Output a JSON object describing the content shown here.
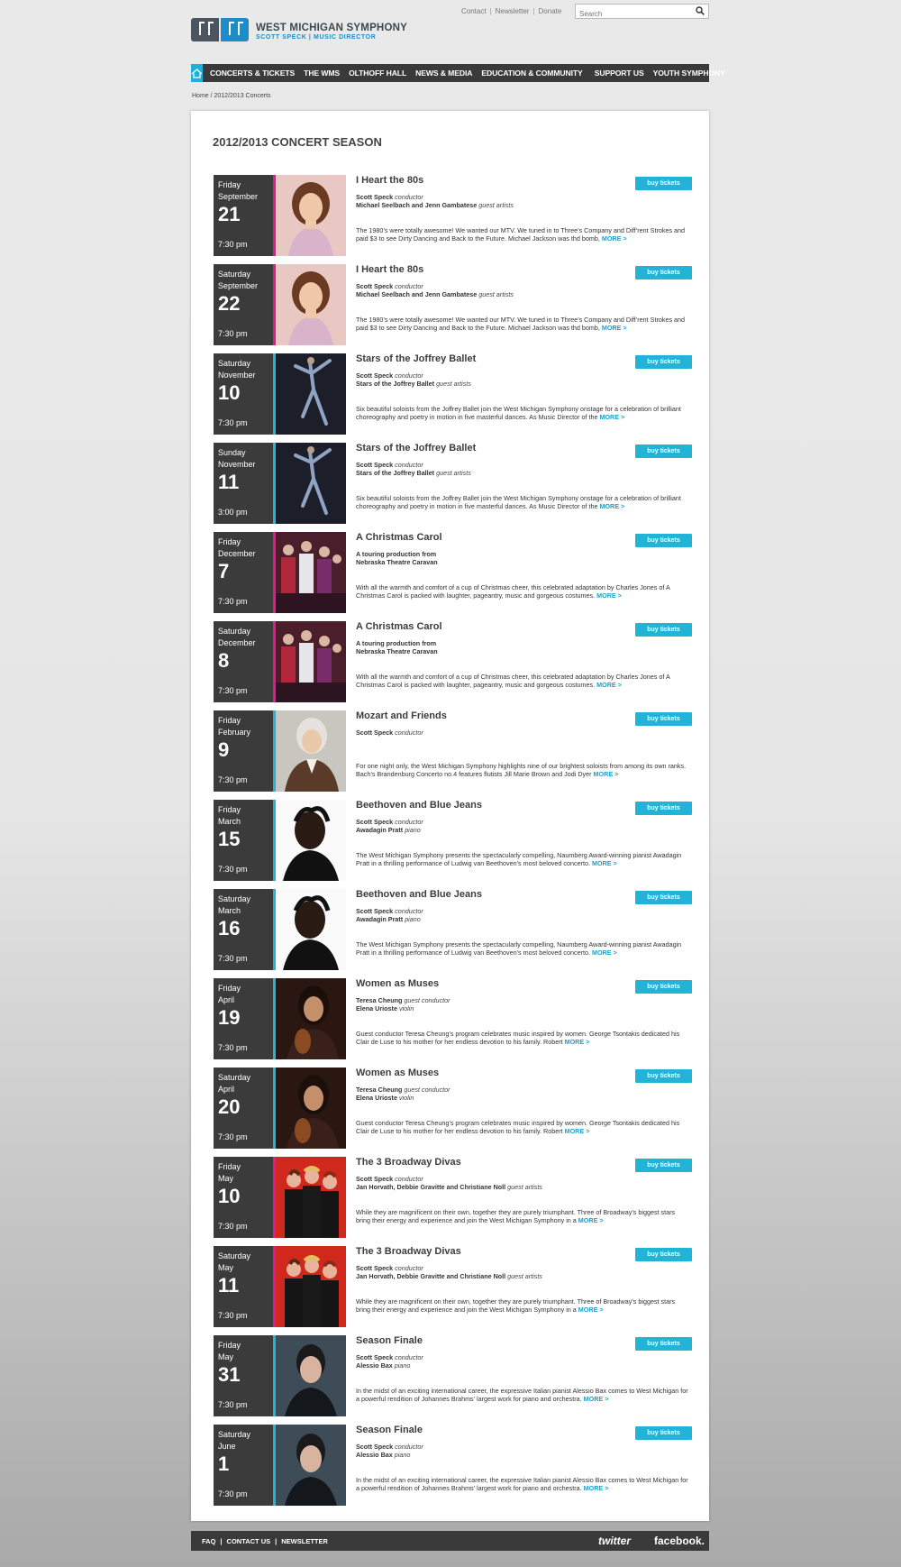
{
  "header": {
    "logo_title": "WEST MICHIGAN SYMPHONY",
    "logo_subtitle": "SCOTT SPECK | MUSIC DIRECTOR",
    "util_links": [
      "Contact",
      "Newsletter",
      "Donate"
    ],
    "search_placeholder": "Search"
  },
  "nav": {
    "items": [
      "CONCERTS & TICKETS",
      "THE WMS",
      "OLTHOFF HALL",
      "NEWS & MEDIA",
      "EDUCATION & COMMUNITY",
      "SUPPORT US",
      "YOUTH SYMPHONY"
    ]
  },
  "breadcrumb": "Home / 2012/2013 Concerts",
  "season_title": "2012/2013 CONCERT SEASON",
  "buy_label": "buy tickets",
  "more_label": "MORE >",
  "colors": {
    "accent": "#22b3d7",
    "magenta": "#e5198a",
    "dark": "#3b3b3b"
  },
  "events": [
    {
      "dow": "Friday",
      "month": "September",
      "day": "21",
      "time": "7:30 pm",
      "stripe": "magenta",
      "photo": "portrait-woman",
      "title": "I Heart the 80s",
      "credits": [
        {
          "name": "Scott Speck",
          "role": "conductor"
        },
        {
          "name": "Michael Seelbach and Jenn Gambatese",
          "role": "guest artists"
        }
      ],
      "desc": "The 1980’s were totally awesome! We wanted our MTV. We tuned in to Three’s Company and Diff’rent Strokes and paid $3 to see Dirty Dancing and Back to the Future. Michael Jackson was thd bomb,"
    },
    {
      "dow": "Saturday",
      "month": "September",
      "day": "22",
      "time": "7:30 pm",
      "stripe": "magenta",
      "photo": "portrait-woman",
      "title": "I Heart the 80s",
      "credits": [
        {
          "name": "Scott Speck",
          "role": "conductor"
        },
        {
          "name": "Michael Seelbach and Jenn Gambatese",
          "role": "guest artists"
        }
      ],
      "desc": "The 1980’s were totally awesome! We wanted our MTV. We tuned in to Three’s Company and Diff’rent Strokes and paid $3 to see Dirty Dancing and Back to the Future. Michael Jackson was thd bomb,"
    },
    {
      "dow": "Saturday",
      "month": "November",
      "day": "10",
      "time": "7:30 pm",
      "stripe": "blue",
      "photo": "ballet",
      "title": "Stars of the Joffrey Ballet",
      "credits": [
        {
          "name": "Scott Speck",
          "role": "conductor"
        },
        {
          "name": "Stars of the Joffrey Ballet",
          "role": "guest artists"
        }
      ],
      "desc": "Six beautiful soloists from the Joffrey Ballet join the West Michigan Symphony onstage for a celebration of brilliant choreography and poetry in motion in five masterful dances. As Music Director of the"
    },
    {
      "dow": "Sunday",
      "month": "November",
      "day": "11",
      "time": "3:00 pm",
      "stripe": "blue",
      "photo": "ballet",
      "title": "Stars of the Joffrey Ballet",
      "credits": [
        {
          "name": "Scott Speck",
          "role": "conductor"
        },
        {
          "name": "Stars of the Joffrey Ballet",
          "role": "guest artists"
        }
      ],
      "desc": "Six beautiful soloists from the Joffrey Ballet join the West Michigan Symphony onstage for a celebration of brilliant choreography and poetry in motion in five masterful dances. As Music Director of the"
    },
    {
      "dow": "Friday",
      "month": "December",
      "day": "7",
      "time": "7:30 pm",
      "stripe": "magenta",
      "photo": "carol",
      "title": "A Christmas Carol",
      "credits": [
        {
          "name": "A touring production from",
          "role": ""
        },
        {
          "name": "Nebraska Theatre Caravan",
          "role": ""
        }
      ],
      "desc": "With all the warmth and comfort of a cup of Christmas cheer, this celebrated adaptation by Charles Jones of A Christmas Carol is packed with laughter, pageantry, music and gorgeous costumes."
    },
    {
      "dow": "Saturday",
      "month": "December",
      "day": "8",
      "time": "7:30 pm",
      "stripe": "magenta",
      "photo": "carol",
      "title": "A Christmas Carol",
      "credits": [
        {
          "name": "A touring production from",
          "role": ""
        },
        {
          "name": "Nebraska Theatre Caravan",
          "role": ""
        }
      ],
      "desc": "With all the warmth and comfort of a cup of Christmas cheer, this celebrated adaptation by Charles Jones of A Christmas Carol is packed with laughter, pageantry, music and gorgeous costumes."
    },
    {
      "dow": "Friday",
      "month": "February",
      "day": "9",
      "time": "7:30 pm",
      "stripe": "blue",
      "photo": "mozart",
      "title": "Mozart and Friends",
      "credits": [
        {
          "name": "Scott Speck",
          "role": "conductor"
        }
      ],
      "desc": "For one night only, the West Michigan Symphony highlights nine of our brightest soloists from among its own ranks. Bach’s Brandenburg Concerto no.4 features flutists Jill Marie Brown and Jodi Dyer"
    },
    {
      "dow": "Friday",
      "month": "March",
      "day": "15",
      "time": "7:30 pm",
      "stripe": "blue",
      "photo": "pianist-man",
      "title": "Beethoven and Blue Jeans",
      "credits": [
        {
          "name": "Scott Speck",
          "role": "conductor"
        },
        {
          "name": "Awadagin Pratt",
          "role": "piano"
        }
      ],
      "desc": "The West Michigan Symphony presents the spectacularly compelling, Naumberg Award-winning pianist Awadagin Pratt in a thrilling performance of Ludwig van Beethoven’s most beloved concerto."
    },
    {
      "dow": "Saturday",
      "month": "March",
      "day": "16",
      "time": "7:30 pm",
      "stripe": "blue",
      "photo": "pianist-man",
      "title": "Beethoven and Blue Jeans",
      "credits": [
        {
          "name": "Scott Speck",
          "role": "conductor"
        },
        {
          "name": "Awadagin Pratt",
          "role": "piano"
        }
      ],
      "desc": "The West Michigan Symphony presents the spectacularly compelling, Naumberg Award-winning pianist Awadagin Pratt in a thrilling performance of Ludwig van Beethoven’s most beloved concerto."
    },
    {
      "dow": "Friday",
      "month": "April",
      "day": "19",
      "time": "7:30 pm",
      "stripe": "blue",
      "photo": "violinist",
      "title": "Women as Muses",
      "credits": [
        {
          "name": "Teresa Cheung",
          "role": "guest conductor"
        },
        {
          "name": "Elena Urioste",
          "role": "violin"
        }
      ],
      "desc": "Guest conductor Teresa Cheung’s program celebrates music inspired by women. George Tsontakis dedicated his Clair de Luse to his mother for her endless devotion to his family. Robert"
    },
    {
      "dow": "Saturday",
      "month": "April",
      "day": "20",
      "time": "7:30 pm",
      "stripe": "blue",
      "photo": "violinist",
      "title": "Women as Muses",
      "credits": [
        {
          "name": "Teresa Cheung",
          "role": "guest conductor"
        },
        {
          "name": "Elena Urioste",
          "role": "violin"
        }
      ],
      "desc": "Guest conductor Teresa Cheung’s program celebrates music inspired by women. George Tsontakis dedicated his Clair de Luse to his mother for her endless devotion to his family. Robert"
    },
    {
      "dow": "Friday",
      "month": "May",
      "day": "10",
      "time": "7:30 pm",
      "stripe": "magenta",
      "photo": "divas",
      "title": "The 3 Broadway Divas",
      "credits": [
        {
          "name": "Scott Speck",
          "role": "conductor"
        },
        {
          "name": "Jan Horvath, Debbie Gravitte and Christiane Noll",
          "role": "guest artists"
        }
      ],
      "desc": "While they are magnificent on their own, together they are purely triumphant. Three of Broadway’s biggest stars bring their energy and experience and join the West Michigan Symphony in a"
    },
    {
      "dow": "Saturday",
      "month": "May",
      "day": "11",
      "time": "7:30 pm",
      "stripe": "magenta",
      "photo": "divas",
      "title": "The 3 Broadway Divas",
      "credits": [
        {
          "name": "Scott Speck",
          "role": "conductor"
        },
        {
          "name": "Jan Horvath, Debbie Gravitte and Christiane Noll",
          "role": "guest artists"
        }
      ],
      "desc": "While they are magnificent on their own, together they are purely triumphant. Three of Broadway’s biggest stars bring their energy and experience and join the West Michigan Symphony in a"
    },
    {
      "dow": "Friday",
      "month": "May",
      "day": "31",
      "time": "7:30 pm",
      "stripe": "blue",
      "photo": "pianist-young",
      "title": "Season Finale",
      "credits": [
        {
          "name": "Scott Speck",
          "role": "conductor"
        },
        {
          "name": "Alessio Bax",
          "role": "piano"
        }
      ],
      "desc": "In the midst of an exciting international career, the expressive Italian pianist Alessio Bax comes to West Michigan for a powerful rendition of Johannes Brahms’ largest work for piano and orchestra."
    },
    {
      "dow": "Saturday",
      "month": "June",
      "day": "1",
      "time": "7:30 pm",
      "stripe": "blue",
      "photo": "pianist-young",
      "title": "Season Finale",
      "credits": [
        {
          "name": "Scott Speck",
          "role": "conductor"
        },
        {
          "name": "Alessio Bax",
          "role": "piano"
        }
      ],
      "desc": "In the midst of an exciting international career, the expressive Italian pianist Alessio Bax comes to West Michigan for a powerful rendition of Johannes Brahms’ largest work for piano and orchestra."
    }
  ],
  "footer": {
    "links": [
      "FAQ",
      "CONTACT US",
      "NEWSLETTER"
    ],
    "twitter": "twitter",
    "facebook": "facebook."
  }
}
